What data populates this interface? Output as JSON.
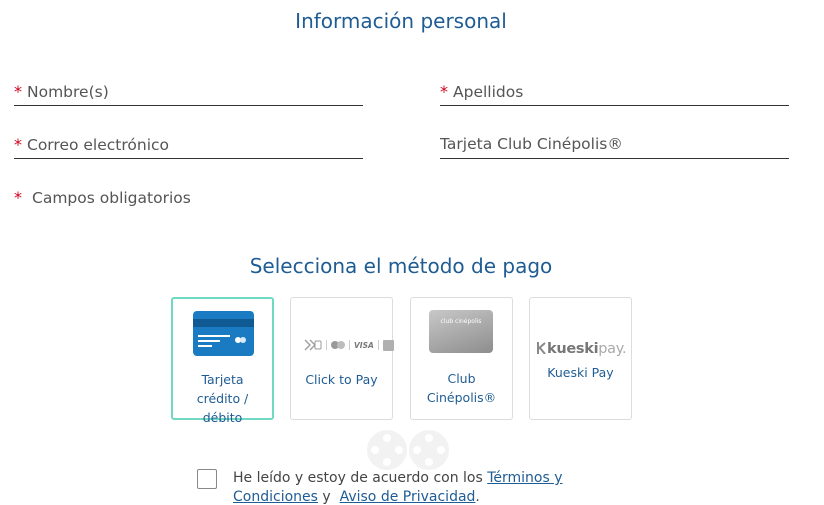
{
  "personal_info": {
    "title": "Información personal",
    "required_mark": "*",
    "fields": {
      "nombre": {
        "label": "Nombre(s)",
        "required": true
      },
      "apellidos": {
        "label": "Apellidos",
        "required": true
      },
      "correo": {
        "label": "Correo electrónico",
        "required": true
      },
      "club": {
        "label": "Tarjeta Club Cinépolis®",
        "required": false
      }
    },
    "required_note": "Campos obligatorios"
  },
  "payment": {
    "title": "Selecciona el método de pago",
    "methods": [
      {
        "id": "tarjeta",
        "label": "Tarjeta crédito / débito",
        "icon": "credit-card-icon",
        "selected": true
      },
      {
        "id": "click_to_pay",
        "label": "Click to Pay",
        "icon": "click-to-pay-logos",
        "selected": false
      },
      {
        "id": "club",
        "label": "Club Cinépolis®",
        "icon": "club-cinepolis-card",
        "selected": false,
        "card_text": "club cinépolis"
      },
      {
        "id": "kueski",
        "label": "Kueski Pay",
        "icon": "kueski-pay-logo",
        "selected": false,
        "logo_text": "kueski",
        "logo_suffix": "pay."
      }
    ],
    "click_to_pay_visa": "VISA"
  },
  "terms": {
    "prefix": "He leído y estoy de acuerdo con los ",
    "terms_link": "Términos y Condiciones",
    "joiner": " y  ",
    "privacy_link": "Aviso de Privacidad",
    "suffix": ".",
    "checked": false
  },
  "colors": {
    "title": "#1f5c93",
    "required": "#d0021b",
    "selected_border": "#6fd9c3",
    "card_blue": "#1b7bc2"
  }
}
